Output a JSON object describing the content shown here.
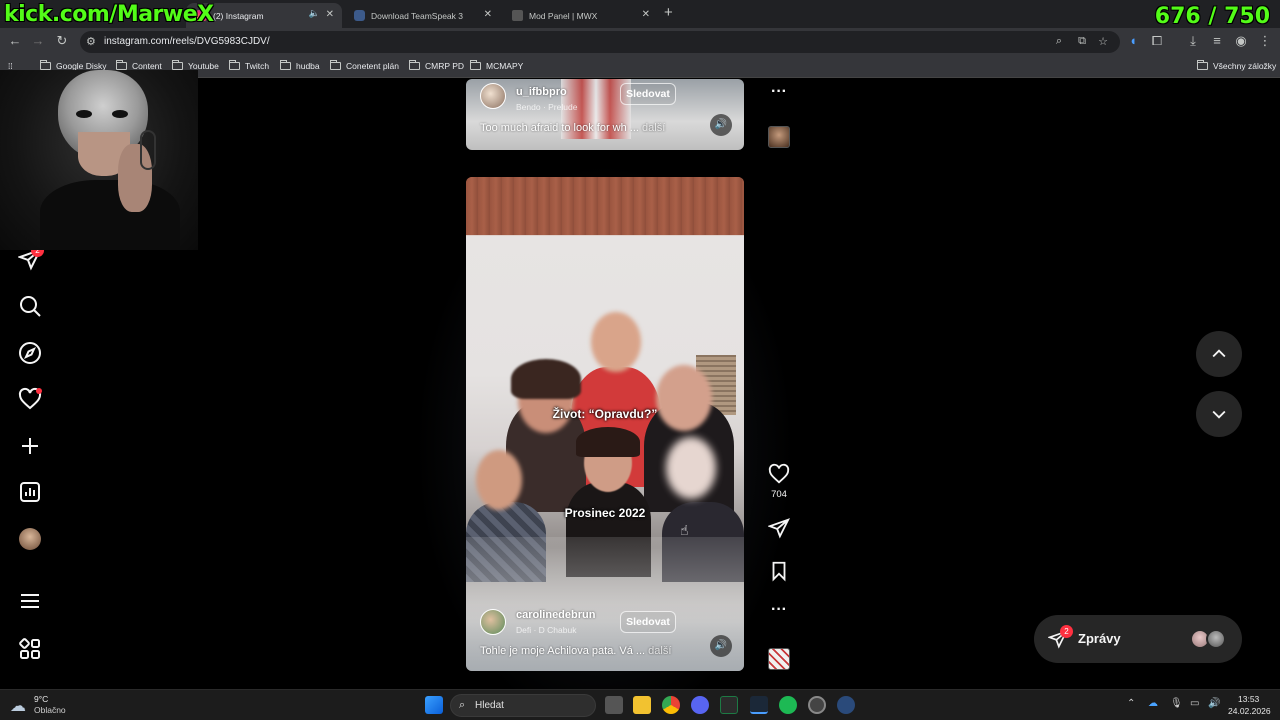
{
  "overlay": {
    "kick_text": "kick.com/MarweX",
    "counter": "676 / 750"
  },
  "tabs": [
    {
      "title": "(2) Instagram",
      "active": true
    },
    {
      "title": "Download TeamSpeak 3",
      "active": false
    },
    {
      "title": "Mod Panel | MWX",
      "active": false
    }
  ],
  "url": "instagram.com/reels/DVG5983CJDV/",
  "bookmarks": {
    "items": [
      "Google Disky",
      "Content",
      "Youtube",
      "Twitch",
      "hudba",
      "Conetent plán",
      "CMRP PD",
      "MCMAPY"
    ],
    "all_bookmarks": "Všechny záložky"
  },
  "sidebar": {
    "notification_badge": "2"
  },
  "reels": {
    "top": {
      "username": "u_ifbbpro",
      "sub": "Bendo · Prelude",
      "follow": "Sledovat",
      "caption": "Too much afraid to look for wh ...",
      "more": "další"
    },
    "main": {
      "overlay_text_1": "Život: “Opravdu?”",
      "overlay_text_2": "Prosinec 2022",
      "username": "carolinedebrun",
      "sub": "Defi · D Chabuk",
      "follow": "Sledovat",
      "caption": "Tohle je moje Achilova pata. Vá ...",
      "more": "další"
    }
  },
  "actions": {
    "likes": "704"
  },
  "messages": {
    "label": "Zprávy",
    "badge": "2"
  },
  "taskbar": {
    "weather_temp": "9°C",
    "weather_desc": "Oblačno",
    "search_placeholder": "Hledat",
    "time": "13:53",
    "date": "24.02.2026"
  },
  "colors": {
    "kick_green": "#53fc18",
    "instagram_red": "#ff3040",
    "page_bg": "#000000"
  }
}
